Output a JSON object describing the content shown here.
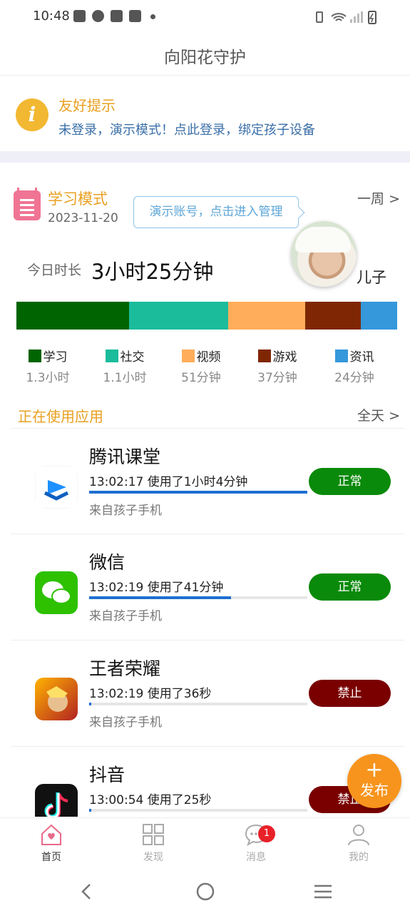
{
  "status_bar": {
    "time": "10:48"
  },
  "header": {
    "title": "向阳花守护"
  },
  "notice": {
    "title": "友好提示",
    "message": "未登录，演示模式！点此登录，绑定孩子设备"
  },
  "summary": {
    "mode": "学习模式",
    "date": "2023-11-20",
    "demo_tip": "演示账号，点击进入管理",
    "period_link": "一周 >",
    "child_name": "儿子",
    "today_label": "今日时长",
    "today_duration": "3小时25分钟"
  },
  "colors": {
    "study": "#006400",
    "social": "#1abc9c",
    "video": "#ffad5a",
    "game": "#7f2704",
    "news": "#3498db",
    "normal": "#0a8a0a",
    "blocked": "#7a0000",
    "accent": "#e8a020"
  },
  "usage_breakdown": [
    {
      "name": "学习",
      "value": "1.3小时",
      "share": 0.296,
      "color": "#006400"
    },
    {
      "name": "社交",
      "value": "1.1小时",
      "share": 0.261,
      "color": "#1abc9c"
    },
    {
      "name": "视频",
      "value": "51分钟",
      "share": 0.202,
      "color": "#ffad5a"
    },
    {
      "name": "游戏",
      "value": "37分钟",
      "share": 0.146,
      "color": "#7f2704"
    },
    {
      "name": "资讯",
      "value": "24分钟",
      "share": 0.095,
      "color": "#3498db"
    }
  ],
  "apps_section": {
    "title": "正在使用应用",
    "filter_link": "全天 >"
  },
  "apps": [
    {
      "name": "腾讯课堂",
      "usage": "13:02:17 使用了1小时4分钟",
      "progress": 1.0,
      "source": "来自孩子手机",
      "status": "正常",
      "status_type": "normal",
      "icon": "tencent-classroom-icon"
    },
    {
      "name": "微信",
      "usage": "13:02:19 使用了41分钟",
      "progress": 0.65,
      "source": "来自孩子手机",
      "status": "正常",
      "status_type": "normal",
      "icon": "wechat-icon"
    },
    {
      "name": "王者荣耀",
      "usage": "13:02:19 使用了36秒",
      "progress": 0.01,
      "source": "来自孩子手机",
      "status": "禁止",
      "status_type": "blocked",
      "icon": "honor-of-kings-icon"
    },
    {
      "name": "抖音",
      "usage": "13:00:54 使用了25秒",
      "progress": 0.01,
      "source": "来自孩子手机",
      "status": "禁止",
      "status_type": "blocked",
      "icon": "douyin-icon"
    }
  ],
  "fab": {
    "plus": "+",
    "label": "发布"
  },
  "tabbar": {
    "home": "首页",
    "discover": "发现",
    "messages": "消息",
    "messages_badge": "1",
    "mine": "我的"
  }
}
